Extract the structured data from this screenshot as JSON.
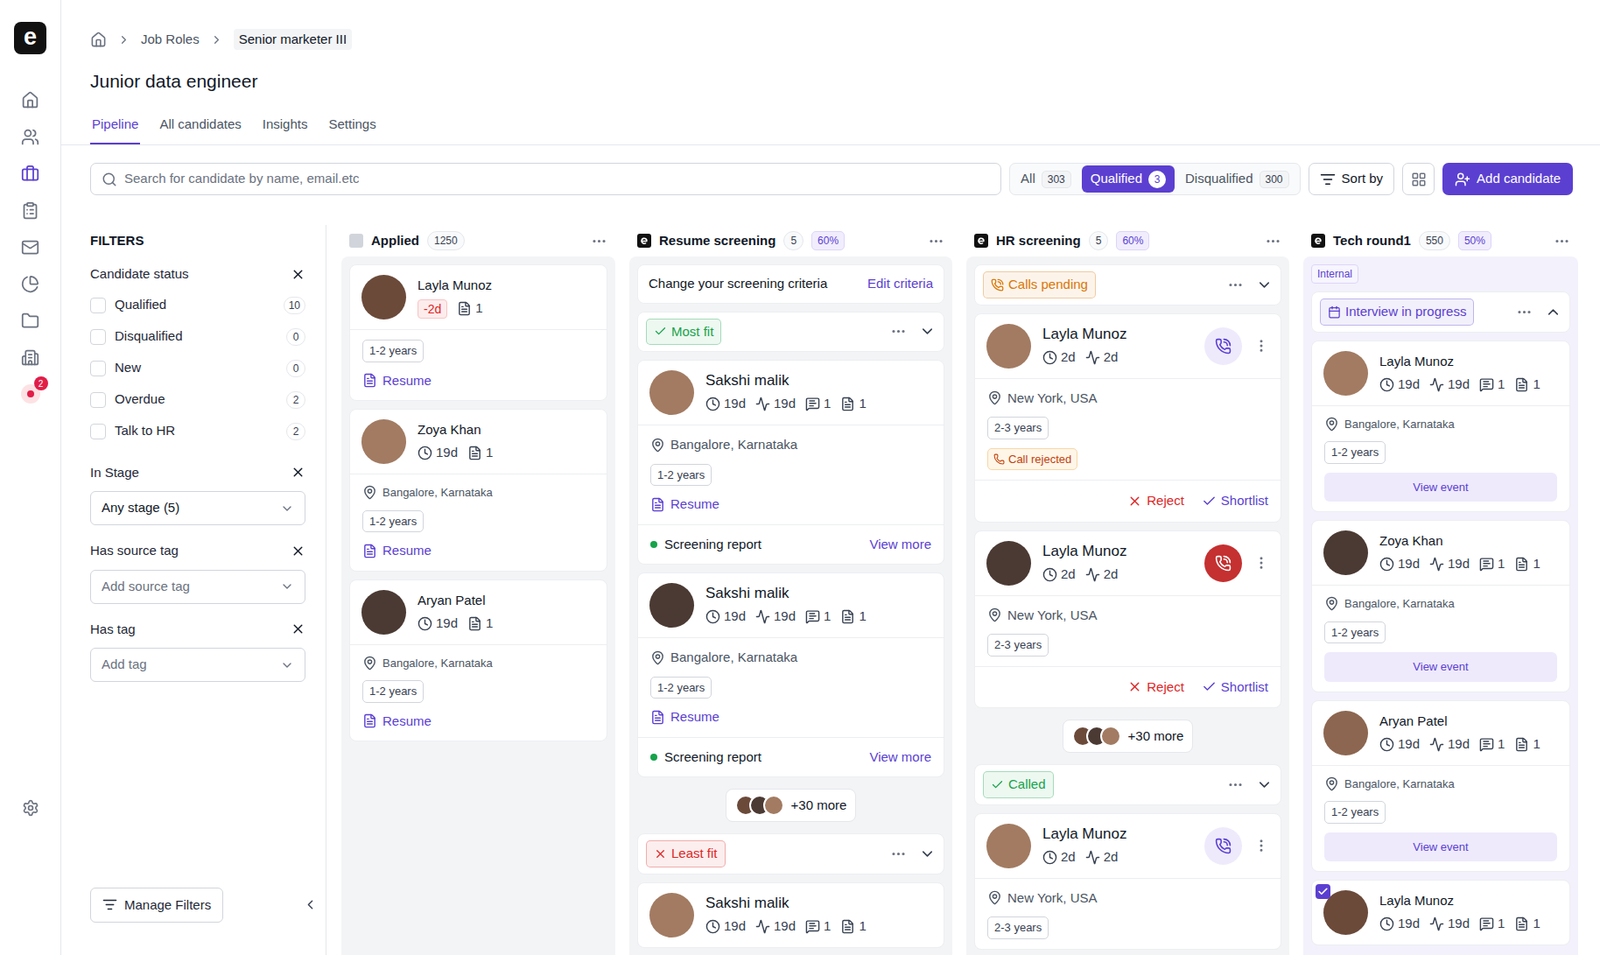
{
  "rail": {
    "logo": "e",
    "items": [
      {
        "selected": false
      },
      {
        "selected": false
      },
      {
        "selected": true
      },
      {
        "selected": false
      },
      {
        "selected": false
      },
      {
        "selected": false
      },
      {
        "selected": false
      },
      {
        "selected": false
      },
      {
        "selected": false,
        "badge": "2"
      }
    ]
  },
  "breadcrumb": [
    "Job Roles",
    "Senior marketer III"
  ],
  "title": "Junior data engineer",
  "tabs": [
    {
      "label": "Pipeline",
      "selected": true
    },
    {
      "label": "All candidates",
      "selected": false
    },
    {
      "label": "Insights",
      "selected": false
    },
    {
      "label": "Settings",
      "selected": false
    }
  ],
  "search": {
    "placeholder": "Search for candidate by name, email.etc"
  },
  "segments": [
    {
      "label": "All",
      "count": "303",
      "selected": false
    },
    {
      "label": "Qualified",
      "count": "3",
      "selected": true
    },
    {
      "label": "Disqualified",
      "count": "300",
      "selected": false
    }
  ],
  "sort": "Sort by",
  "add_button": "Add candidate",
  "filters": {
    "title": "FILTERS",
    "status": {
      "label": "Candidate status",
      "options": [
        {
          "label": "Qualified",
          "count": "10",
          "checked": false
        },
        {
          "label": "Disqualified",
          "count": "0",
          "checked": false
        },
        {
          "label": "New",
          "count": "0",
          "checked": false
        },
        {
          "label": "Overdue",
          "count": "2",
          "checked": false
        },
        {
          "label": "Talk to HR",
          "count": "2",
          "checked": false
        }
      ]
    },
    "selects": [
      {
        "label": "In Stage",
        "value": "Any stage (5)"
      },
      {
        "label": "Has source tag",
        "placeholder": "Add source tag"
      },
      {
        "label": "Has tag",
        "placeholder": "Add tag"
      }
    ],
    "manage": "Manage Filters"
  },
  "columns": [
    {
      "kind": "applied",
      "title": "Applied",
      "count": "1250",
      "items": [
        {
          "kind": "card",
          "name": "Layla Munoz",
          "overdue": "-2d",
          "notes": "1",
          "experience": "1-2 years",
          "resume": "Resume"
        },
        {
          "kind": "card",
          "name": "Zoya Khan",
          "time": "19d",
          "notes": "1",
          "location": "Bangalore, Karnataka",
          "experience": "1-2 years",
          "resume": "Resume"
        },
        {
          "kind": "card",
          "name": "Aryan Patel",
          "time": "19d",
          "notes": "1",
          "location": "Bangalore, Karnataka",
          "experience": "1-2 years",
          "resume": "Resume"
        }
      ]
    },
    {
      "kind": "screening",
      "title": "Resume screening",
      "count": "5",
      "percent": "60%",
      "note": {
        "text": "Change your screening criteria",
        "action": "Edit criteria"
      },
      "items": [
        {
          "kind": "group",
          "label": "Most fit",
          "status": "positive",
          "color": "#16a34a",
          "expanded": false
        },
        {
          "kind": "card",
          "name": "Sakshi malik",
          "time": "19d",
          "activity": "19d",
          "comments": "1",
          "notes": "1",
          "location": "Bangalore, Karnataka",
          "experience": "1-2 years",
          "resume": "Resume",
          "report": {
            "label": "Screening report",
            "action": "View more"
          }
        },
        {
          "kind": "card",
          "name": "Sakshi malik",
          "time": "19d",
          "activity": "19d",
          "comments": "1",
          "notes": "1",
          "location": "Bangalore, Karnataka",
          "experience": "1-2 years",
          "resume": "Resume",
          "report": {
            "label": "Screening report",
            "action": "View more"
          }
        },
        {
          "kind": "more",
          "label": "+30 more"
        },
        {
          "kind": "group",
          "label": "Least fit",
          "status": "negative",
          "color": "#dc2626",
          "expanded": false
        },
        {
          "kind": "card",
          "name": "Sakshi malik",
          "time": "19d",
          "activity": "19d",
          "comments": "1",
          "notes": "1"
        }
      ]
    },
    {
      "kind": "calls",
      "title": "HR screening",
      "count": "5",
      "percent": "60%",
      "items": [
        {
          "kind": "group",
          "label": "Calls pending",
          "status": "pending",
          "color": "#d97706",
          "expanded": false
        },
        {
          "kind": "card",
          "name": "Layla Munoz",
          "time": "2d",
          "activity": "2d",
          "calling": false,
          "location": "New York, USA",
          "experience": "2-3 years",
          "tag": "Call rejected",
          "actions": {
            "reject": "Reject",
            "shortlist": "Shortlist"
          }
        },
        {
          "kind": "card",
          "name": "Layla Munoz",
          "time": "2d",
          "activity": "2d",
          "calling": true,
          "location": "New York, USA",
          "experience": "2-3 years",
          "actions": {
            "reject": "Reject",
            "shortlist": "Shortlist"
          }
        },
        {
          "kind": "more",
          "label": "+30 more"
        },
        {
          "kind": "group",
          "label": "Called",
          "status": "positive",
          "color": "#16a34a",
          "expanded": false
        },
        {
          "kind": "card",
          "name": "Layla Munoz",
          "time": "2d",
          "activity": "2d",
          "calling": false,
          "location": "New York, USA",
          "experience": "2-3 years"
        }
      ]
    },
    {
      "kind": "interview",
      "title": "Tech round1",
      "count": "550",
      "percent": "50%",
      "label": "Internal",
      "items": [
        {
          "kind": "group",
          "label": "Interview in progress",
          "status": "scheduled",
          "color": "#5b3fd1",
          "expanded": true
        },
        {
          "kind": "card",
          "name": "Layla Munoz",
          "time": "19d",
          "activity": "19d",
          "comments": "1",
          "notes": "1",
          "location": "Bangalore, Karnataka",
          "experience": "1-2 years",
          "event": "View event",
          "checked": false
        },
        {
          "kind": "card",
          "name": "Zoya Khan",
          "time": "19d",
          "activity": "19d",
          "comments": "1",
          "notes": "1",
          "location": "Bangalore, Karnataka",
          "experience": "1-2 years",
          "event": "View event",
          "checked": false
        },
        {
          "kind": "card",
          "name": "Aryan Patel",
          "time": "19d",
          "activity": "19d",
          "comments": "1",
          "notes": "1",
          "location": "Bangalore, Karnataka",
          "experience": "1-2 years",
          "event": "View event",
          "checked": false
        },
        {
          "kind": "card",
          "name": "Layla Munoz",
          "time": "19d",
          "activity": "19d",
          "comments": "1",
          "notes": "1",
          "checked": true
        }
      ]
    }
  ]
}
